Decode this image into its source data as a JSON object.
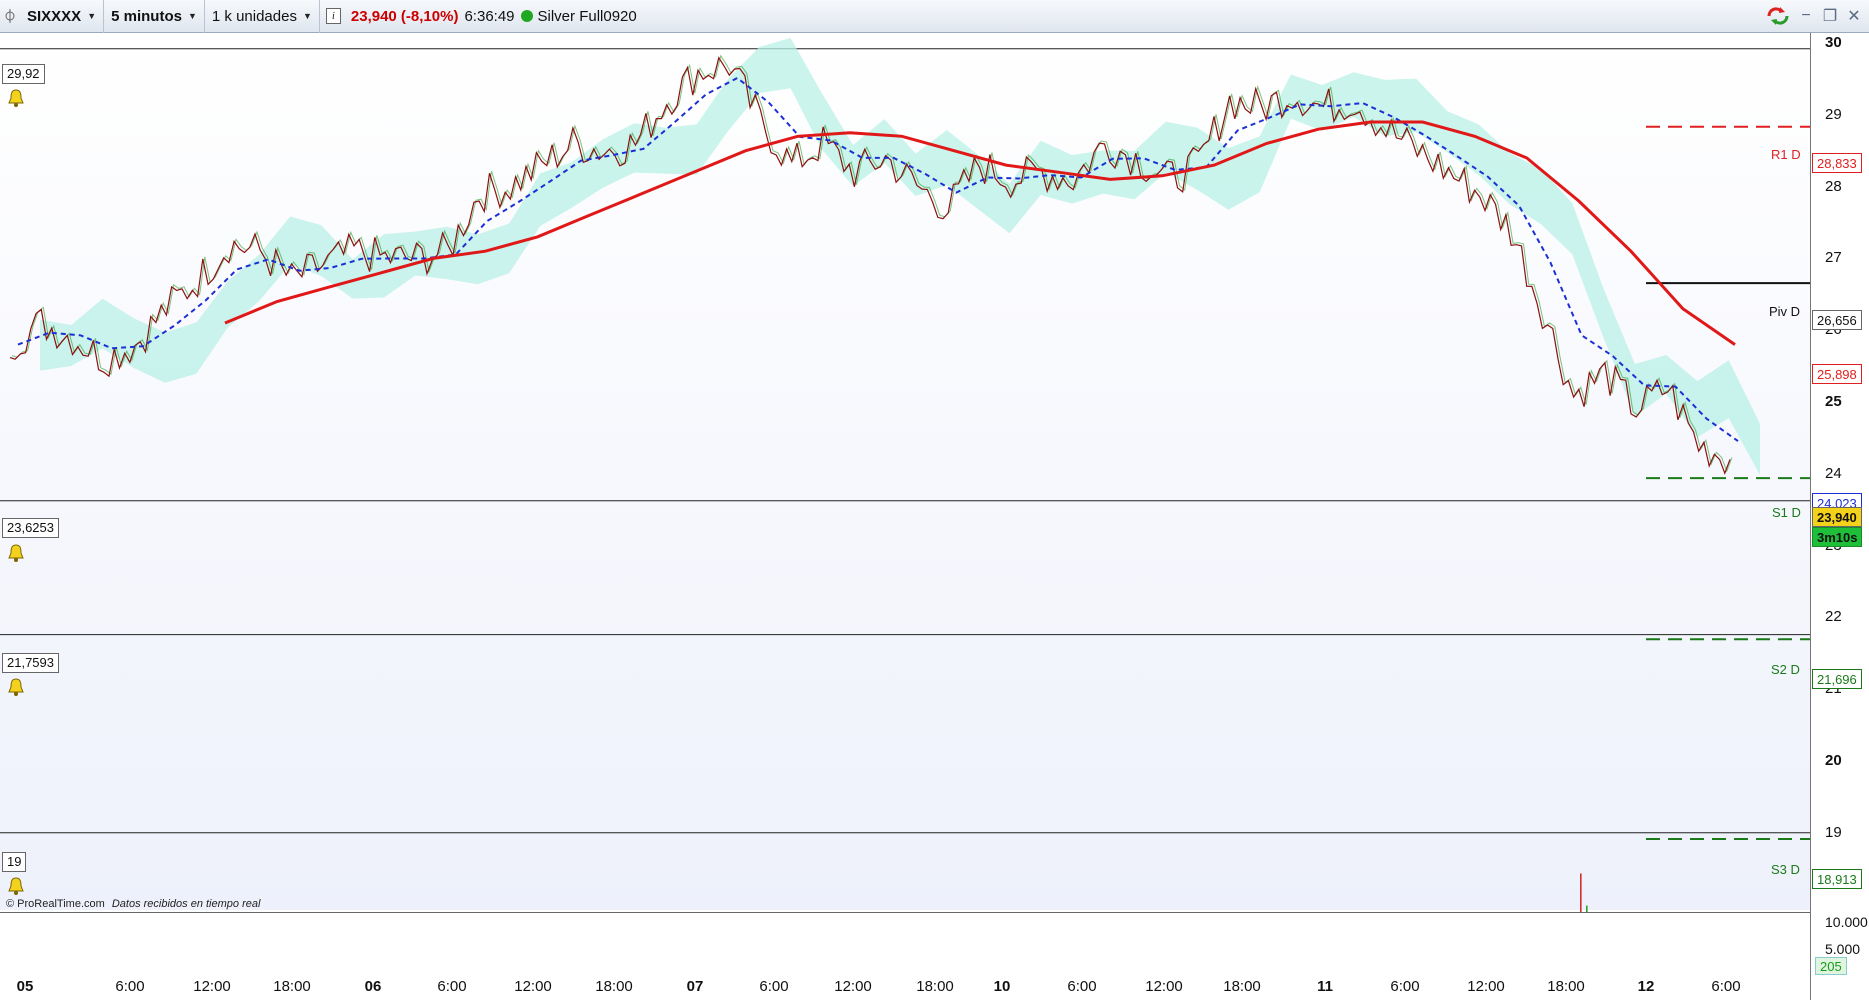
{
  "toolbar": {
    "symbol": "SIXXXX",
    "timeframe": "5 minutos",
    "units": "1 k unidades",
    "info_icon": "i",
    "price_change": "23,940 (-8,10%)",
    "time": "6:36:49",
    "status_name": "Silver Full0920",
    "status_color": "#1fa821"
  },
  "window_buttons": {
    "minimize": "−",
    "restore": "❐",
    "close": "✕"
  },
  "pane_levels": [
    {
      "label": "29,92"
    },
    {
      "label": "23,6253"
    },
    {
      "label": "21,7593"
    },
    {
      "label": "19"
    }
  ],
  "attribution": {
    "brand": "© ProRealTime.com",
    "note": "Datos recibidos en tiempo real"
  },
  "pivots": [
    {
      "name": "R1 D",
      "value": "28,833",
      "color": "#e02020",
      "style": "dashed"
    },
    {
      "name": "Piv D",
      "value": "26,656",
      "color": "#111111",
      "style": "solid"
    },
    {
      "name": "S1 D",
      "value": "23,940",
      "color": "#1a7a1a",
      "style": "dashed"
    },
    {
      "name": "S2 D",
      "value": "21,696",
      "color": "#1a7a1a",
      "style": "dashed"
    },
    {
      "name": "S3 D",
      "value": "18,913",
      "color": "#1a7a1a",
      "style": "dashed"
    }
  ],
  "right_labels": {
    "red_level": "25,898",
    "blue_level": "24,023",
    "current_price": "23,940",
    "countdown": "3m10s"
  },
  "volume_axis": [
    "10.000",
    "5.000",
    "205"
  ],
  "colors": {
    "price": "#8b1010",
    "sma_long": "#e01818",
    "ema_short": "#1c2fd6",
    "cloud": "#b8f0e6",
    "pivot_red": "#e02020",
    "pivot_green": "#1a7a1a"
  },
  "chart_data": {
    "type": "line",
    "title": "",
    "ylim": [
      18.5,
      30.2
    ],
    "y_ticks": [
      "30",
      "29",
      "28",
      "27",
      "26",
      "25",
      "24",
      "23",
      "22",
      "21",
      "20",
      "19"
    ],
    "x_ticks": [
      "05",
      "6:00",
      "12:00",
      "18:00",
      "06",
      "6:00",
      "12:00",
      "18:00",
      "07",
      "6:00",
      "12:00",
      "18:00",
      "10",
      "6:00",
      "12:00",
      "18:00",
      "11",
      "6:00",
      "12:00",
      "18:00",
      "12",
      "6:00"
    ],
    "series": [
      {
        "values": [
          25.8,
          26.1,
          25.9,
          25.6,
          25.8,
          26.3,
          26.7,
          27.2,
          27.1,
          26.7,
          26.9,
          27.1,
          27.0,
          27.0,
          27.1,
          27.9,
          28.0,
          28.3,
          28.6,
          28.5,
          28.6,
          29.2,
          29.6,
          29.7,
          28.9,
          28.3,
          28.6,
          28.2,
          28.4,
          28.0,
          27.7,
          28.3,
          28.1,
          28.2,
          28.1,
          28.6,
          28.4,
          28.1,
          28.3,
          29.2,
          29.1,
          29.3,
          29.1,
          29.2,
          28.8,
          28.5,
          28.2,
          27.9,
          27.4,
          26.3,
          25.1,
          25.4,
          24.9,
          25.2,
          24.4,
          24.2
        ]
      },
      {
        "name": "",
        "values": [
          null,
          null,
          null,
          null,
          null,
          26.1,
          26.4,
          26.6,
          26.8,
          27.0,
          27.1,
          27.3,
          27.6,
          27.9,
          28.2,
          28.5,
          28.7,
          28.75,
          28.7,
          28.5,
          28.3,
          28.2,
          28.1,
          28.15,
          28.3,
          28.6,
          28.8,
          28.9,
          28.9,
          28.7,
          28.4,
          27.8,
          27.1,
          26.3,
          25.8
        ]
      }
    ]
  }
}
